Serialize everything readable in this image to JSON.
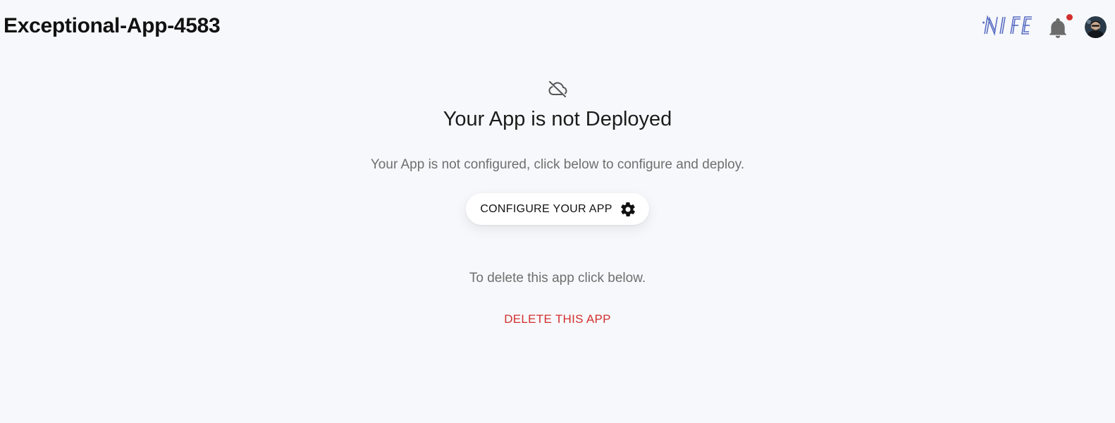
{
  "header": {
    "app_title": "Exceptional-App-4583",
    "logo_text": "NIFE",
    "notification_icon": "bell-icon",
    "avatar_icon": "user-avatar"
  },
  "main": {
    "status_icon": "cloud-off-icon",
    "status_title": "Your App is not Deployed",
    "status_description": "Your App is not configured, click below to configure and deploy.",
    "configure_button_label": "CONFIGURE YOUR APP",
    "configure_button_icon": "gear-icon",
    "delete_description": "To delete this app click below.",
    "delete_button_label": "DELETE THIS APP"
  },
  "colors": {
    "background": "#f7f8fb",
    "danger": "#d32f2f",
    "notification_dot": "#d32f2f",
    "logo_blue": "#5b6fc4"
  }
}
